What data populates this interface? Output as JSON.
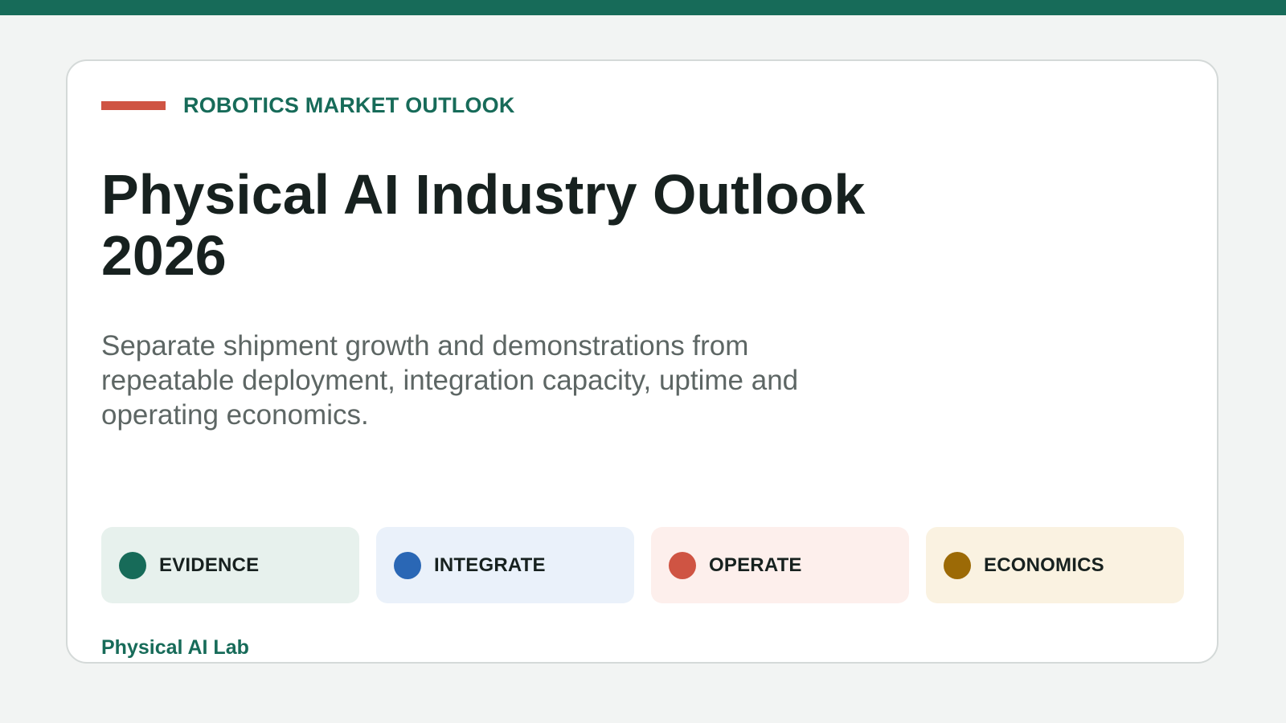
{
  "header": {
    "eyebrow": "ROBOTICS MARKET OUTLOOK",
    "title": "Physical AI Industry Outlook 2026",
    "subtitle": "Separate shipment growth and demonstrations from repeatable deployment, integration capacity, uptime and operating economics."
  },
  "pillars": [
    {
      "label": "EVIDENCE",
      "dot_color": "#176b59",
      "bg_color": "#e7f1ed"
    },
    {
      "label": "INTEGRATE",
      "dot_color": "#2a67b5",
      "bg_color": "#eaf1fa"
    },
    {
      "label": "OPERATE",
      "dot_color": "#cf5443",
      "bg_color": "#fdefec"
    },
    {
      "label": "ECONOMICS",
      "dot_color": "#9c6a06",
      "bg_color": "#faf2e1"
    }
  ],
  "footer": {
    "brand": "Physical AI Lab"
  },
  "colors": {
    "accent": "#176b59",
    "highlight": "#cf5443",
    "background": "#f2f4f3",
    "card": "#ffffff"
  }
}
